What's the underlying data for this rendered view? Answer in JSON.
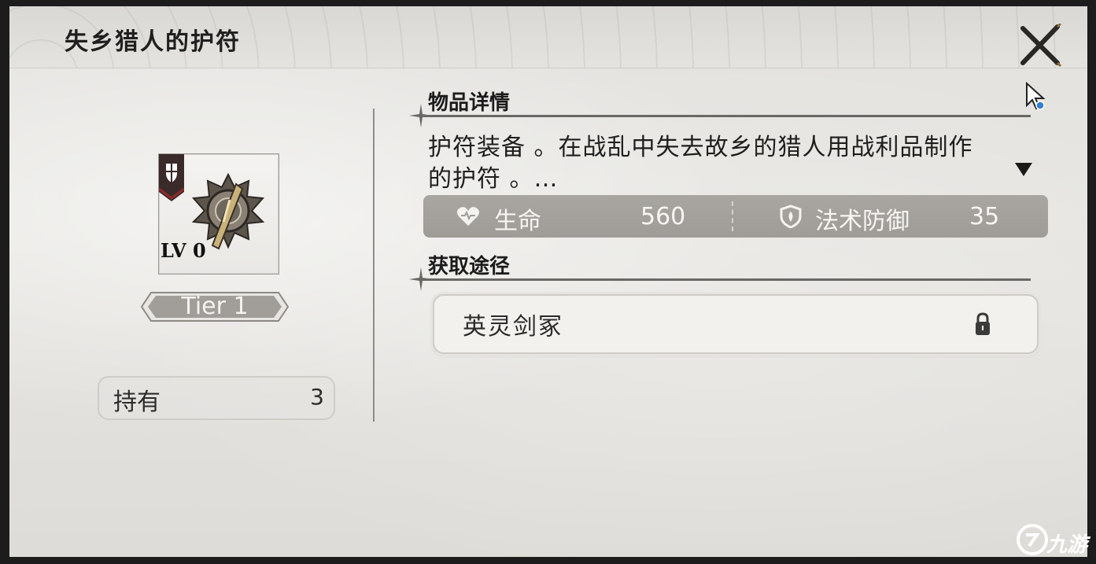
{
  "header": {
    "title": "失乡猎人的护符"
  },
  "item": {
    "level_label": "LV 0",
    "tier_label": "Tier 1",
    "hold": {
      "label": "持有",
      "value": "3"
    }
  },
  "details": {
    "section_title": "物品详情",
    "description": "护符装备 。在战乱中失去故乡的猎人用战利品制作的护符 。…",
    "stats": [
      {
        "label": "生命",
        "value": "560",
        "icon": "heart-icon"
      },
      {
        "label": "法术防御",
        "value": "35",
        "icon": "shield-icon"
      }
    ]
  },
  "source": {
    "section_title": "获取途径",
    "items": [
      {
        "label": "英灵剑冢",
        "locked": true
      }
    ]
  },
  "watermark": {
    "text": "九游"
  },
  "colors": {
    "stat_bar": "#a39f9a",
    "panel_bg": "#e3e2df",
    "text_dark": "#1e1e1e"
  }
}
